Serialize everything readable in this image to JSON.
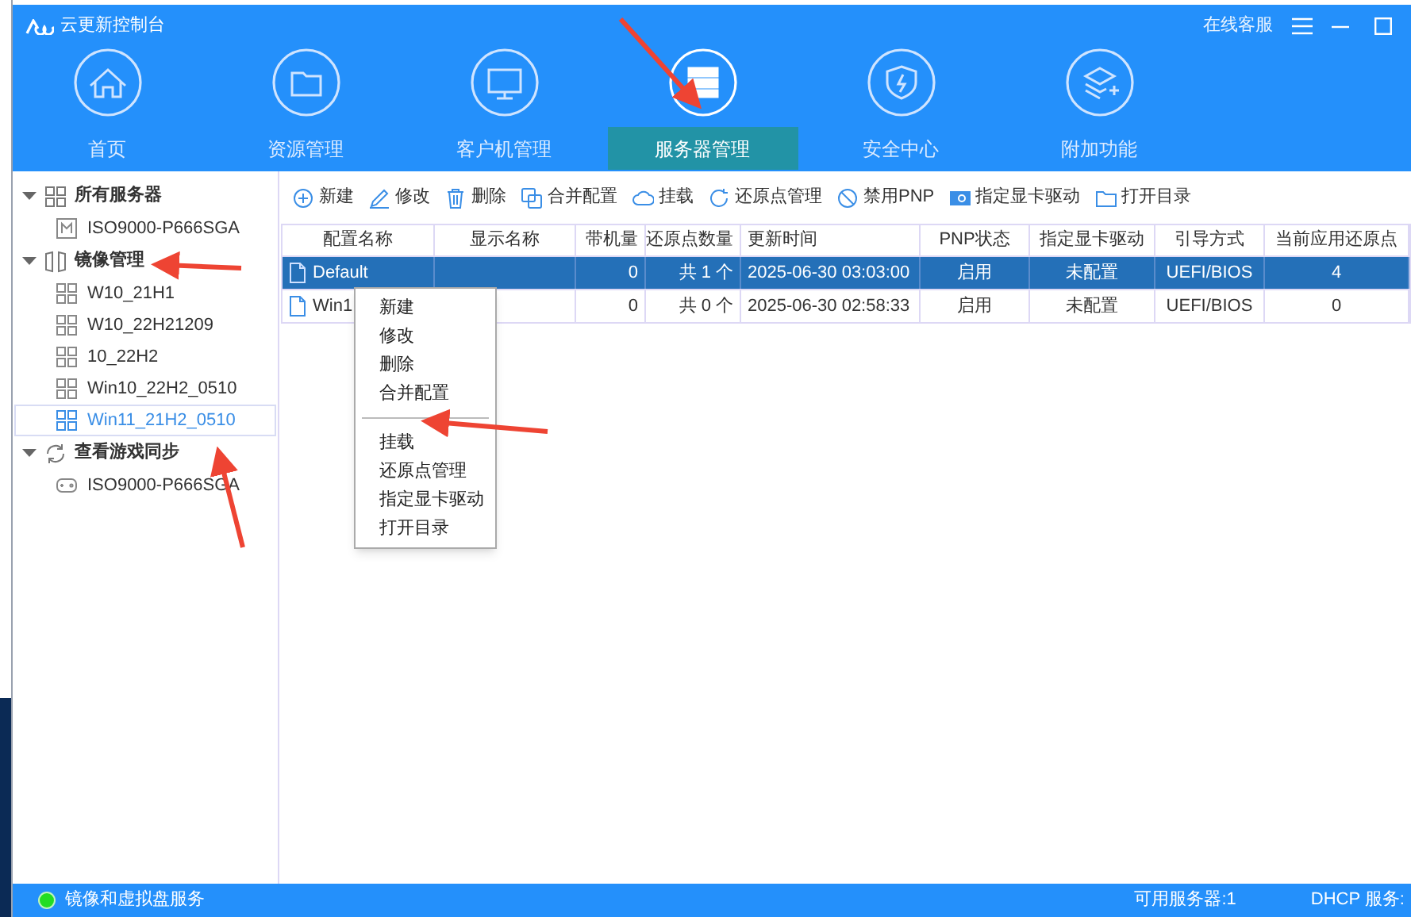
{
  "window": {
    "title": "云更新控制台",
    "support_link": "在线客服"
  },
  "nav_tabs": [
    {
      "label": "首页",
      "selected": false
    },
    {
      "label": "资源管理",
      "selected": false
    },
    {
      "label": "客户机管理",
      "selected": false
    },
    {
      "label": "服务器管理",
      "selected": true
    },
    {
      "label": "安全中心",
      "selected": false
    },
    {
      "label": "附加功能",
      "selected": false
    }
  ],
  "sidebar": {
    "groups": [
      {
        "label": "所有服务器",
        "kind": "servers",
        "expanded": true,
        "children": [
          {
            "label": "ISO9000-P666SGA",
            "selected": false
          }
        ]
      },
      {
        "label": "镜像管理",
        "kind": "images",
        "expanded": true,
        "children": [
          {
            "label": "W10_21H1",
            "selected": false
          },
          {
            "label": "W10_22H21209",
            "selected": false
          },
          {
            "label": "10_22H2",
            "selected": false
          },
          {
            "label": "Win10_22H2_0510",
            "selected": false
          },
          {
            "label": "Win11_21H2_0510",
            "selected": true
          }
        ]
      },
      {
        "label": "查看游戏同步",
        "kind": "sync",
        "expanded": true,
        "children": [
          {
            "label": "ISO9000-P666SGA",
            "selected": false
          }
        ]
      }
    ]
  },
  "toolbar": [
    "新建",
    "修改",
    "删除",
    "合并配置",
    "挂载",
    "还原点管理",
    "禁用PNP",
    "指定显卡驱动",
    "打开目录"
  ],
  "table": {
    "columns": [
      "配置名称",
      "显示名称",
      "带机量",
      "还原点数量",
      "更新时间",
      "PNP状态",
      "指定显卡驱动",
      "引导方式",
      "当前应用还原点"
    ],
    "rows": [
      {
        "selected": true,
        "cells": [
          "Default",
          "",
          "0",
          "共 1 个",
          "2025-06-30 03:03:00",
          "启用",
          "未配置",
          "UEFI/BIOS",
          "4"
        ]
      },
      {
        "selected": false,
        "cells": [
          "Win1",
          "",
          "0",
          "共 0 个",
          "2025-06-30 02:58:33",
          "启用",
          "未配置",
          "UEFI/BIOS",
          "0"
        ]
      }
    ]
  },
  "context_menu": [
    {
      "label": "新建",
      "separator_before": false
    },
    {
      "label": "修改",
      "separator_before": false
    },
    {
      "label": "删除",
      "separator_before": false
    },
    {
      "label": "合并配置",
      "separator_before": false
    },
    {
      "label": "挂载",
      "separator_before": true
    },
    {
      "label": "还原点管理",
      "separator_before": false
    },
    {
      "label": "指定显卡驱动",
      "separator_before": false
    },
    {
      "label": "打开目录",
      "separator_before": false
    }
  ],
  "status_bar": {
    "service": {
      "label": "镜像和虚拟盘服务",
      "color": "#22dd22"
    },
    "available_servers": "可用服务器:1",
    "dhcp": "DHCP 服务:"
  }
}
